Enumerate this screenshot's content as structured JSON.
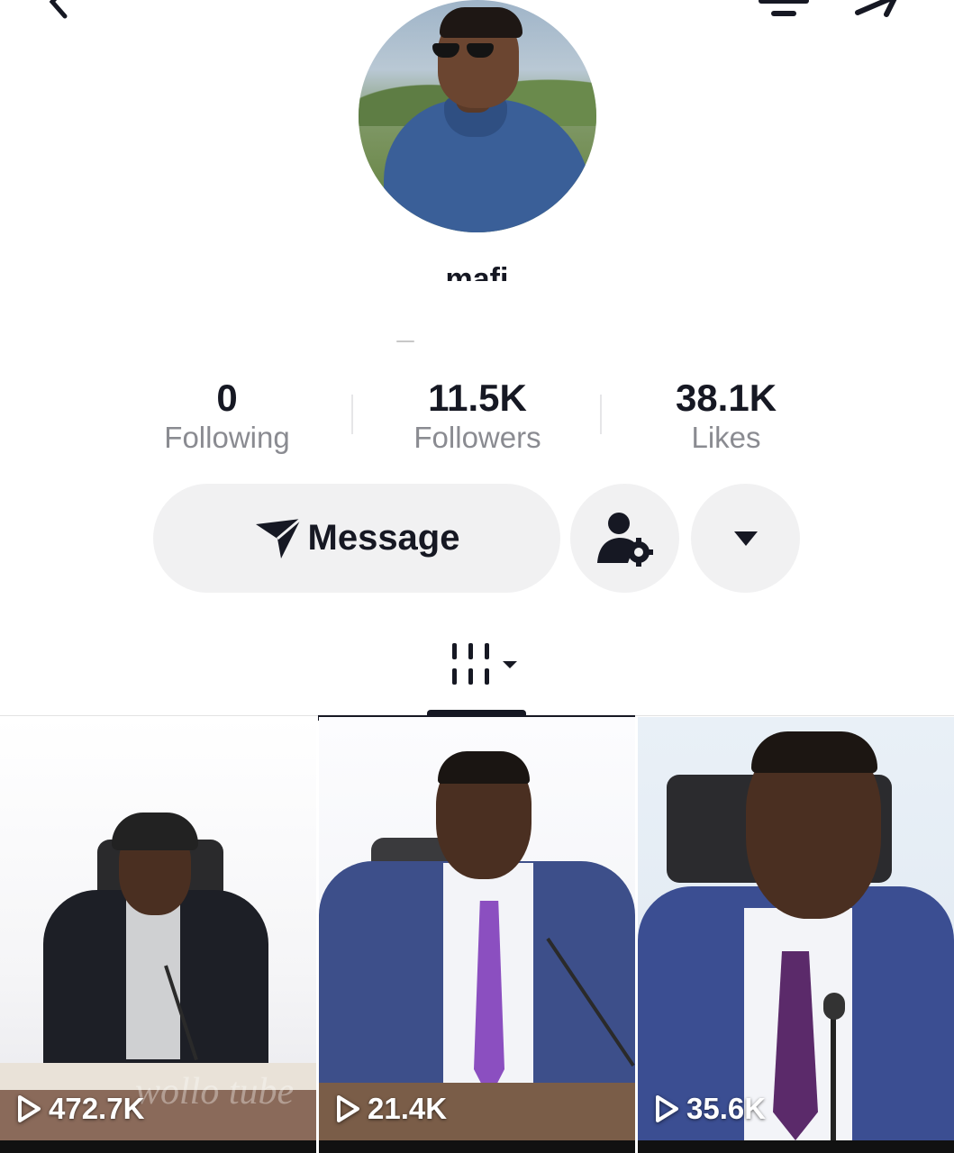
{
  "profile": {
    "username": "mafi"
  },
  "stats": {
    "following": {
      "value": "0",
      "label": "Following"
    },
    "followers": {
      "value": "11.5K",
      "label": "Followers"
    },
    "likes": {
      "value": "38.1K",
      "label": "Likes"
    }
  },
  "actions": {
    "message_label": "Message"
  },
  "icons": {
    "back": "chevron-left-icon",
    "filter": "filter-icon",
    "share": "share-icon",
    "message": "send-icon",
    "follow_settings": "user-settings-icon",
    "more": "caret-down-icon",
    "videos_tab": "grid-icon",
    "play": "play-icon"
  },
  "videos": [
    {
      "views": "472.7K",
      "watermark": "wollo tube"
    },
    {
      "views": "21.4K"
    },
    {
      "views": "35.6K"
    }
  ],
  "colors": {
    "text": "#161823",
    "secondary_text": "#8a8b91",
    "button_bg": "#f1f1f2"
  }
}
